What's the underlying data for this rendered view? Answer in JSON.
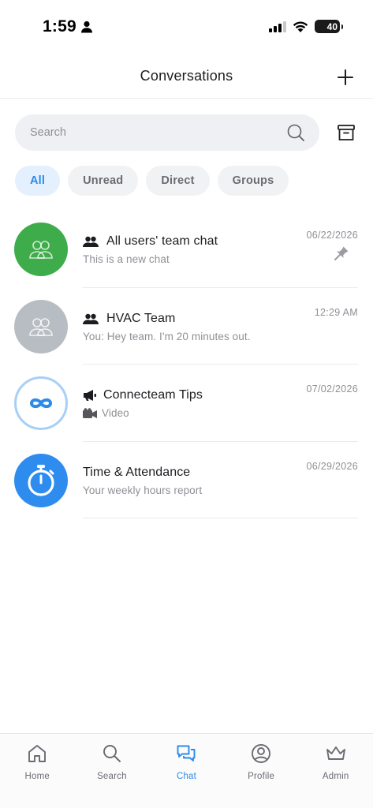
{
  "status_bar": {
    "time": "1:59",
    "battery": "40"
  },
  "header": {
    "title": "Conversations"
  },
  "search": {
    "placeholder": "Search"
  },
  "filters": [
    {
      "label": "All",
      "active": true
    },
    {
      "label": "Unread",
      "active": false
    },
    {
      "label": "Direct",
      "active": false
    },
    {
      "label": "Groups",
      "active": false
    }
  ],
  "conversations": [
    {
      "name": "All users' team chat",
      "preview": "This is a new chat",
      "date": "06/22/2026",
      "type_icon": "group-icon",
      "avatar_color": "#3fac4b",
      "pinned": true
    },
    {
      "name": "HVAC Team",
      "preview": "You: Hey team. I'm 20 minutes out.",
      "date": "12:29 AM",
      "type_icon": "group-icon",
      "avatar_color": "#b7bdc2",
      "pinned": false
    },
    {
      "name": "Connecteam Tips",
      "preview": "Video",
      "date": "07/02/2026",
      "type_icon": "megaphone-icon",
      "avatar_color": "#ffffff",
      "pinned": false
    },
    {
      "name": "Time & Attendance",
      "preview": "Your weekly hours report",
      "date": "06/29/2026",
      "type_icon": "",
      "avatar_color": "#2d8cee",
      "pinned": false
    }
  ],
  "bottom_nav": [
    {
      "label": "Home",
      "icon": "home-icon",
      "active": false
    },
    {
      "label": "Search",
      "icon": "search-icon",
      "active": false
    },
    {
      "label": "Chat",
      "icon": "chat-icon",
      "active": true
    },
    {
      "label": "Profile",
      "icon": "profile-icon",
      "active": false
    },
    {
      "label": "Admin",
      "icon": "crown-icon",
      "active": false
    }
  ],
  "colors": {
    "accent": "#2c8be8",
    "active_chip_bg": "#e4f0fd",
    "muted_text": "#8e9096"
  }
}
